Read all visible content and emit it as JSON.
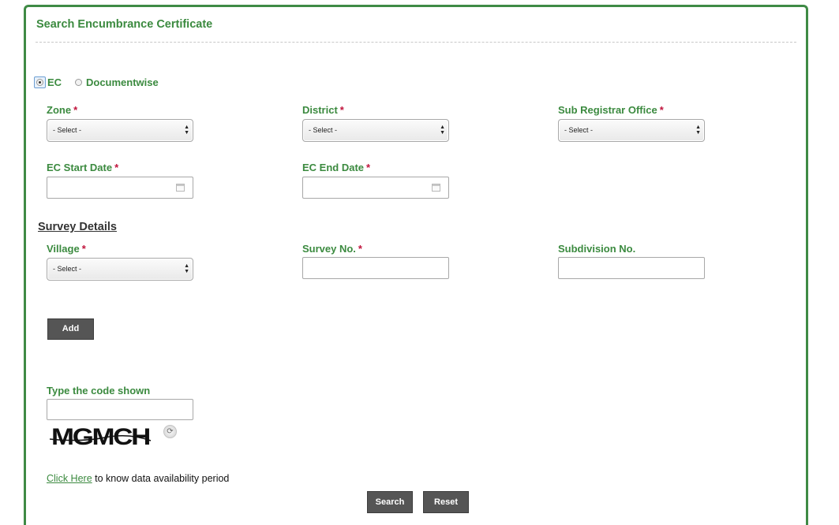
{
  "panel": {
    "title": "Search Encumbrance Certificate"
  },
  "search_type": {
    "options": [
      {
        "label": "EC",
        "checked": true
      },
      {
        "label": "Documentwise",
        "checked": false
      }
    ]
  },
  "fields": {
    "zone": {
      "label": "Zone",
      "required": "*",
      "value": "- Select -"
    },
    "district": {
      "label": "District",
      "required": "*",
      "value": "- Select -"
    },
    "sro": {
      "label": "Sub Registrar Office",
      "required": "*",
      "value": "- Select -"
    },
    "ec_start": {
      "label": "EC Start Date",
      "required": "*",
      "value": ""
    },
    "ec_end": {
      "label": "EC End Date",
      "required": "*",
      "value": ""
    }
  },
  "survey": {
    "title": "Survey Details",
    "village": {
      "label": "Village",
      "required": "*",
      "value": "- Select -"
    },
    "survey_no": {
      "label": "Survey No.",
      "required": "*",
      "value": ""
    },
    "subdivision": {
      "label": "Subdivision No.",
      "value": ""
    },
    "add_label": "Add"
  },
  "captcha": {
    "label": "Type the code shown",
    "value": "",
    "code": "MGMCH",
    "refresh_icon": "refresh-icon"
  },
  "availability": {
    "link": "Click Here",
    "text": " to know data availability period"
  },
  "actions": {
    "search_label": "Search",
    "reset_label": "Reset"
  },
  "colors": {
    "accent": "#3b8a3f",
    "required": "#c0143c",
    "button": "#555555"
  }
}
